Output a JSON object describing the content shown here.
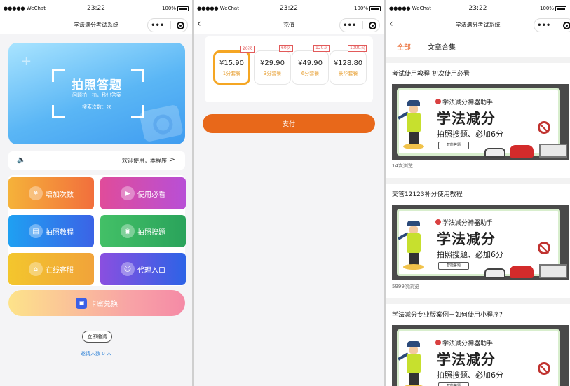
{
  "status_bar": {
    "signal": "●●●●● WeChat",
    "time": "23:22",
    "battery": "100%"
  },
  "screen1": {
    "nav_title": "学法满分考试系统",
    "capsule_more": "•••",
    "hero": {
      "title": "拍照答题",
      "subtitle": "问题拍一拍，秒出答案",
      "count": "搜索次数：次"
    },
    "notice": "欢迎使用，本程序",
    "menu": [
      {
        "label": "增加次数"
      },
      {
        "label": "使用必看"
      },
      {
        "label": "拍照教程"
      },
      {
        "label": "拍照搜题"
      },
      {
        "label": "在线客服"
      },
      {
        "label": "代理入口"
      }
    ],
    "card_exchange": "卡密兑换",
    "invite_button": "立即邀请",
    "invite_count": "邀请人数 0 人"
  },
  "screen2": {
    "nav_title": "充值",
    "packages": [
      {
        "badge": "20次",
        "price": "¥15.90",
        "name": "1分套餐",
        "selected": true
      },
      {
        "badge": "60次",
        "price": "¥29.90",
        "name": "3分套餐",
        "selected": false
      },
      {
        "badge": "120次",
        "price": "¥49.90",
        "name": "6分套餐",
        "selected": false
      },
      {
        "badge": "1000次",
        "price": "¥128.80",
        "name": "豪华套餐",
        "selected": false
      }
    ],
    "pay_button": "支付",
    "accent": "#e8681a"
  },
  "screen3": {
    "nav_title": "学法满分考试系统",
    "tabs": [
      "全部",
      "文章合集"
    ],
    "banner": {
      "line1": "学法减分神器助手",
      "big": "学法减分",
      "sub": "拍照搜题、必加6分",
      "tag": "智能答题"
    },
    "articles": [
      {
        "title": "考试使用教程 初次使用必看",
        "views": "14次浏览"
      },
      {
        "title": "交管12123补分使用教程",
        "views": "5999次浏览"
      },
      {
        "title": "学法减分专业版案例－如何使用小程序?",
        "views": ""
      }
    ]
  }
}
